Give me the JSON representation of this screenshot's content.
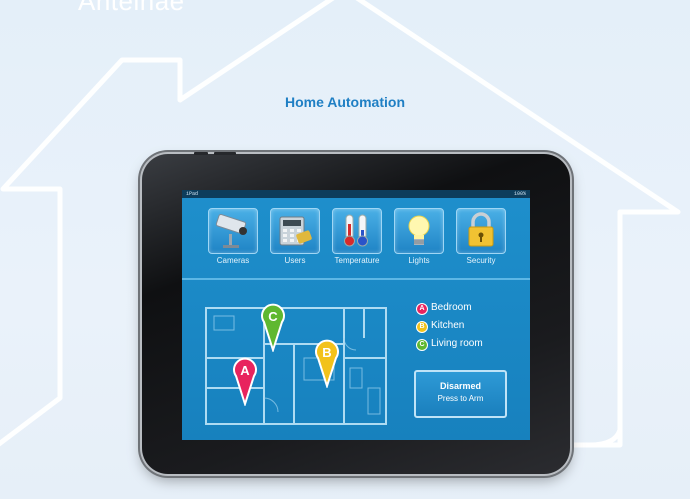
{
  "header": {
    "top_text": "Anteinae",
    "title": "Home Automation"
  },
  "tablet": {
    "status_left": "iPad",
    "status_right": "100%",
    "tiles": [
      {
        "label": "Cameras",
        "icon": "camera-icon"
      },
      {
        "label": "Users",
        "icon": "users-icon"
      },
      {
        "label": "Temperature",
        "icon": "thermometer-icon"
      },
      {
        "label": "Lights",
        "icon": "lightbulb-icon"
      },
      {
        "label": "Security",
        "icon": "lock-icon"
      }
    ],
    "floorplan": {
      "markers": [
        {
          "letter": "A",
          "color": "#e8245e"
        },
        {
          "letter": "B",
          "color": "#f2c21b"
        },
        {
          "letter": "C",
          "color": "#5fb830"
        }
      ]
    },
    "legend": [
      {
        "badge": "A",
        "label": "Bedroom",
        "color": "#e8245e"
      },
      {
        "badge": "B",
        "label": "Kitchen",
        "color": "#f2c21b"
      },
      {
        "badge": "C",
        "label": "Living room",
        "color": "#5fb830"
      }
    ],
    "alarm": {
      "status": "Disarmed",
      "action": "Press to Arm"
    }
  },
  "colors": {
    "background": "#e6f0f9",
    "title": "#1f7fc4",
    "screen": "#1a87c4"
  }
}
